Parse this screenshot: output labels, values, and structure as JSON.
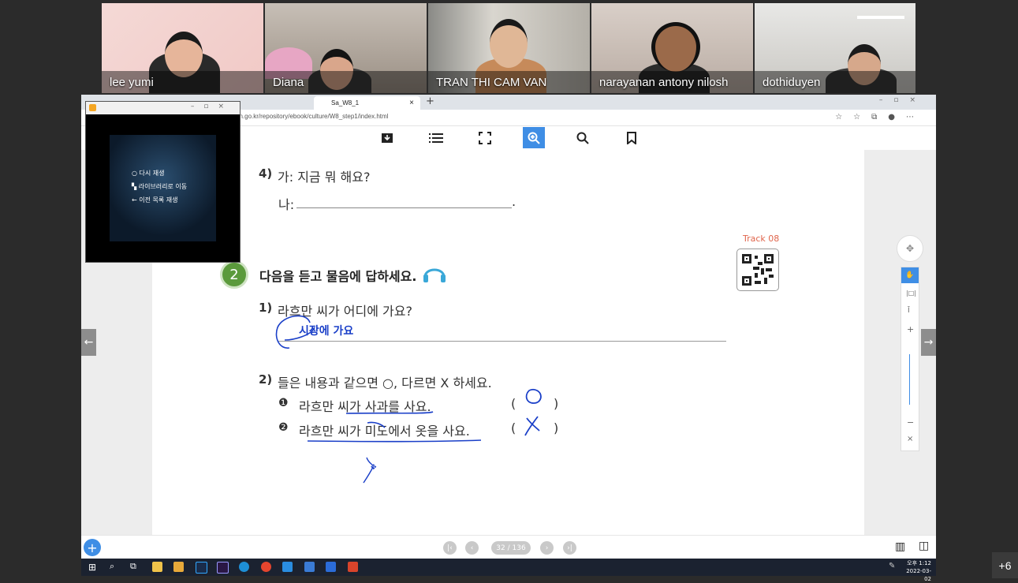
{
  "participants": [
    {
      "name": "lee yumi"
    },
    {
      "name": "Diana"
    },
    {
      "name": "TRAN THI CAM VAN"
    },
    {
      "name": "narayanan antony nilosh"
    },
    {
      "name": "dothiduyen"
    }
  ],
  "extra_participants": "+6",
  "browser": {
    "tabs": [
      "…",
      "…",
      "Sa_W8_1"
    ],
    "address": "an.go.kr/repository/ebook/culture/W8_step1/index.html"
  },
  "media_player": {
    "items": [
      "다시 재생",
      "라이브러리로 이동",
      "이전 목록 재생"
    ]
  },
  "ebook": {
    "q4": {
      "number": "4)",
      "line1": "가: 지금 뭐 해요?",
      "line2_prefix": "나:",
      "line2_suffix": "."
    },
    "track_label": "Track 08",
    "section": {
      "number": "2",
      "title": "다음을 듣고 물음에 답하세요."
    },
    "q1": {
      "number": "1)",
      "text": "라흐만 씨가 어디에 가요?",
      "handwritten_answer": "시장에 가요"
    },
    "q2": {
      "number": "2)",
      "text": "들은 내용과 같으면 ○, 다르면 X 하세요.",
      "items": [
        {
          "marker": "❶",
          "text": "라흐만 씨가 사과를 사요.",
          "paren_open": "(",
          "paren_close": ")"
        },
        {
          "marker": "❷",
          "text": "라흐만 씨가 미도에서 옷을 사요.",
          "paren_open": "(",
          "paren_close": ")"
        }
      ]
    },
    "page_indicator": "32 / 136"
  },
  "taskbar": {
    "time": "오후 1:12",
    "date": "2022-03-02"
  },
  "colors": {
    "accent": "#3f8ee5",
    "section_green": "#5b9a3c",
    "track_red": "#e0654c",
    "ink_blue": "#1a3fc8"
  }
}
